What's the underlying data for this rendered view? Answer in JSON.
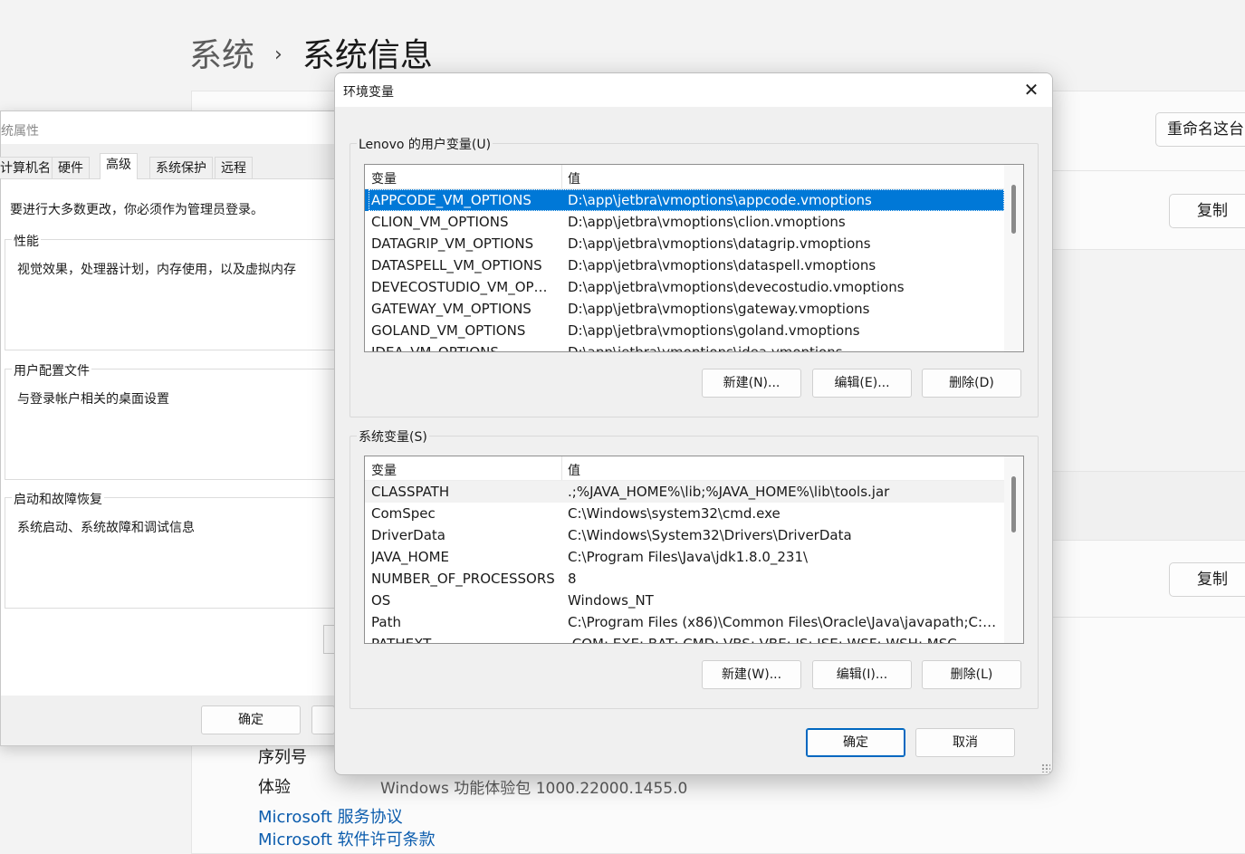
{
  "settings_page": {
    "breadcrumb_parent": "系统",
    "breadcrumb_sep": "›",
    "page_title": "系统信息",
    "rename_button": "重命名这台",
    "copy_button_1": "复制",
    "copy_button_2": "复制",
    "specs": [
      {
        "label": "序列号",
        "value": ""
      },
      {
        "label": "体验",
        "value": "Windows 功能体验包 1000.22000.1455.0"
      }
    ],
    "links": [
      "Microsoft 服务协议",
      "Microsoft 软件许可条款"
    ]
  },
  "system_properties": {
    "title": "统属性",
    "tabs": [
      "计算机名",
      "硬件",
      "高级",
      "系统保护",
      "远程"
    ],
    "active_tab": "高级",
    "admin_note": "要进行大多数更改，你必须作为管理员登录。",
    "groups": [
      {
        "title": "性能",
        "text": "视觉效果，处理器计划，内存使用，以及虚拟内存"
      },
      {
        "title": "用户配置文件",
        "text": "与登录帐户相关的桌面设置"
      },
      {
        "title": "启动和故障恢复",
        "text": "系统启动、系统故障和调试信息"
      }
    ],
    "ok_button": "确定"
  },
  "env_dialog": {
    "title": "环境变量",
    "close_glyph": "✕",
    "user_section": {
      "title": "Lenovo 的用户变量(U)",
      "col_name": "变量",
      "col_value": "值",
      "rows": [
        {
          "name": "APPCODE_VM_OPTIONS",
          "value": "D:\\app\\jetbra\\vmoptions\\appcode.vmoptions"
        },
        {
          "name": "CLION_VM_OPTIONS",
          "value": "D:\\app\\jetbra\\vmoptions\\clion.vmoptions"
        },
        {
          "name": "DATAGRIP_VM_OPTIONS",
          "value": "D:\\app\\jetbra\\vmoptions\\datagrip.vmoptions"
        },
        {
          "name": "DATASPELL_VM_OPTIONS",
          "value": "D:\\app\\jetbra\\vmoptions\\dataspell.vmoptions"
        },
        {
          "name": "DEVECOSTUDIO_VM_OPTI...",
          "value": "D:\\app\\jetbra\\vmoptions\\devecostudio.vmoptions"
        },
        {
          "name": "GATEWAY_VM_OPTIONS",
          "value": "D:\\app\\jetbra\\vmoptions\\gateway.vmoptions"
        },
        {
          "name": "GOLAND_VM_OPTIONS",
          "value": "D:\\app\\jetbra\\vmoptions\\goland.vmoptions"
        },
        {
          "name": "IDEA_VM_OPTIONS",
          "value": "D:\\app\\jetbra\\vmoptions\\idea.vmoptions"
        }
      ],
      "selected_index": 0,
      "buttons": {
        "new": "新建(N)...",
        "edit": "编辑(E)...",
        "delete": "删除(D)"
      }
    },
    "system_section": {
      "title": "系统变量(S)",
      "col_name": "变量",
      "col_value": "值",
      "rows": [
        {
          "name": "CLASSPATH",
          "value": ".;%JAVA_HOME%\\lib;%JAVA_HOME%\\lib\\tools.jar"
        },
        {
          "name": "ComSpec",
          "value": "C:\\Windows\\system32\\cmd.exe"
        },
        {
          "name": "DriverData",
          "value": "C:\\Windows\\System32\\Drivers\\DriverData"
        },
        {
          "name": "JAVA_HOME",
          "value": "C:\\Program Files\\Java\\jdk1.8.0_231\\"
        },
        {
          "name": "NUMBER_OF_PROCESSORS",
          "value": "8"
        },
        {
          "name": "OS",
          "value": "Windows_NT"
        },
        {
          "name": "Path",
          "value": "C:\\Program Files (x86)\\Common Files\\Oracle\\Java\\javapath;C:\\W..."
        },
        {
          "name": "PATHEXT",
          "value": ".COM;.EXE;.BAT;.CMD;.VBS;.VBE;.JS;.JSE;.WSF;.WSH;.MSC"
        }
      ],
      "hover_index": 0,
      "buttons": {
        "new": "新建(W)...",
        "edit": "编辑(I)...",
        "delete": "删除(L)"
      }
    },
    "ok_button": "确定",
    "cancel_button": "取消"
  }
}
